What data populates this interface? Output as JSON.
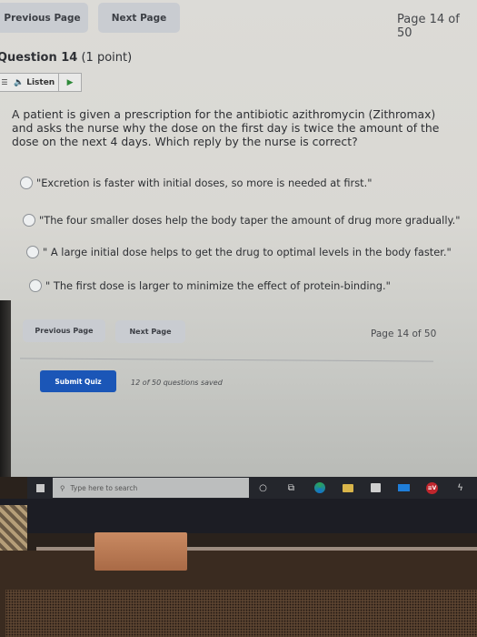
{
  "top_nav": {
    "previous_label": "Previous Page",
    "next_label": "Next Page",
    "page_indicator": "Page 14 of 50"
  },
  "question": {
    "title": "Question 14",
    "points": "(1 point)",
    "listen_label": "Listen",
    "text": "A patient is given a prescription for the antibiotic azithromycin (Zithromax) and asks the nurse why the dose on the first day is twice the amount of the dose on the next 4 days. Which reply by the nurse is correct?",
    "options": [
      {
        "label": "\"Excretion is faster with initial doses, so more is needed at first.\"",
        "selected": false
      },
      {
        "label": "\"The four smaller doses help the body taper the amount of drug more gradually.\"",
        "selected": false
      },
      {
        "label": "\" A large initial dose helps to get the drug to optimal levels in the body faster.\"",
        "selected": false
      },
      {
        "label": "\" The first dose is larger to minimize the effect of protein-binding.\"",
        "selected": false
      }
    ]
  },
  "bottom_nav": {
    "previous_label": "Previous Page",
    "next_label": "Next Page",
    "page_indicator": "Page 14 of 50"
  },
  "submit": {
    "label": "Submit Quiz",
    "saved_status": "12 of 50 questions saved"
  },
  "taskbar": {
    "search_placeholder": "Type here to search",
    "vpn_badge": "≡V",
    "icons": [
      "windows-start-icon",
      "cortana-icon",
      "task-view-icon",
      "edge-icon",
      "file-explorer-icon",
      "store-icon",
      "mail-icon",
      "vpn-icon",
      "app-icon"
    ]
  },
  "colors": {
    "submit_blue": "#1b56b7",
    "button_gray": "#c9ccd1",
    "play_green": "#2f8a3a"
  }
}
